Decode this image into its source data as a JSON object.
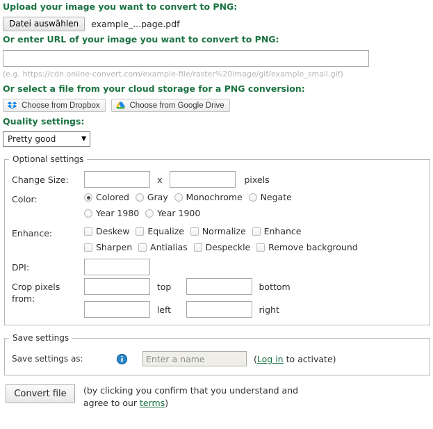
{
  "upload": {
    "heading": "Upload your image you want to convert to PNG:",
    "choose_file_label": "Datei auswählen",
    "file_name": "example_...page.pdf"
  },
  "url": {
    "heading": "Or enter URL of your image you want to convert to PNG:",
    "value": "",
    "placeholder": "",
    "hint": "(e.g. https://cdn.online-convert.com/example-file/raster%20image/gif/example_small.gif)"
  },
  "cloud": {
    "heading": "Or select a file from your cloud storage for a PNG conversion:",
    "dropbox_label": "Choose from Dropbox",
    "dropbox_icon": "dropbox-icon",
    "gdrive_label": "Choose from Google Drive",
    "gdrive_icon": "google-drive-icon"
  },
  "quality": {
    "heading": "Quality settings:",
    "selected": "Pretty good",
    "options": [
      "Pretty good"
    ],
    "arrow_icon": "chevron-down-icon"
  },
  "optional": {
    "legend": "Optional settings",
    "change_size": {
      "label": "Change Size:",
      "width_value": "",
      "separator": "x",
      "height_value": "",
      "unit": "pixels"
    },
    "color": {
      "label": "Color:",
      "options": [
        {
          "label": "Colored",
          "checked": true
        },
        {
          "label": "Gray",
          "checked": false
        },
        {
          "label": "Monochrome",
          "checked": false
        },
        {
          "label": "Negate",
          "checked": false
        },
        {
          "label": "Year 1980",
          "checked": false
        },
        {
          "label": "Year 1900",
          "checked": false
        }
      ]
    },
    "enhance": {
      "label": "Enhance:",
      "options": [
        {
          "label": "Deskew",
          "checked": false
        },
        {
          "label": "Equalize",
          "checked": false
        },
        {
          "label": "Normalize",
          "checked": false
        },
        {
          "label": "Enhance",
          "checked": false
        },
        {
          "label": "Sharpen",
          "checked": false
        },
        {
          "label": "Antialias",
          "checked": false
        },
        {
          "label": "Despeckle",
          "checked": false
        },
        {
          "label": "Remove background",
          "checked": false
        }
      ]
    },
    "dpi": {
      "label": "DPI:",
      "value": ""
    },
    "crop": {
      "label": "Crop pixels from:",
      "top_value": "",
      "top_unit": "top",
      "bottom_value": "",
      "bottom_unit": "bottom",
      "left_value": "",
      "left_unit": "left",
      "right_value": "",
      "right_unit": "right"
    }
  },
  "save_settings": {
    "legend": "Save settings",
    "label": "Save settings as:",
    "info_icon": "info-icon",
    "name_value": "",
    "name_placeholder": "Enter a name",
    "note_prefix": "(",
    "login_link": "Log in",
    "note_suffix": " to activate)"
  },
  "convert": {
    "button_label": "Convert file",
    "terms_prefix": "(by clicking you confirm that you understand and agree to our ",
    "terms_link": "terms",
    "terms_suffix": ")"
  },
  "colors": {
    "heading_green": "#1a7340",
    "link_green": "#1a7340",
    "dropbox_blue": "#0f82e2",
    "info_blue": "#1a6ea8"
  }
}
